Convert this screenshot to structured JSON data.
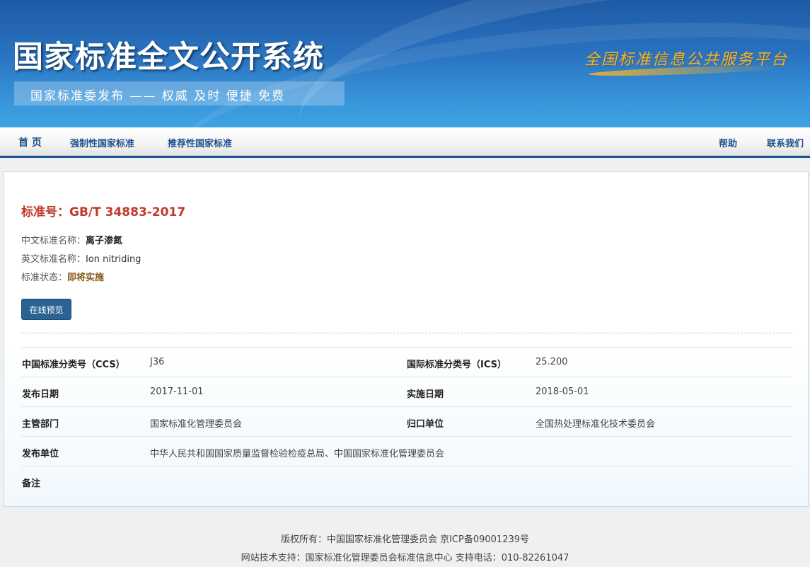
{
  "banner": {
    "title": "国家标准全文公开系统",
    "subtitle": "国家标准委发布 —— 权威 及时 便捷 免费",
    "platform": "全国标准信息公共服务平台"
  },
  "nav": {
    "home": "首 页",
    "mandatory": "强制性国家标准",
    "recommended": "推荐性国家标准",
    "help": "帮助",
    "contact": "联系我们"
  },
  "standard": {
    "number_label": "标准号：GB/T 34883-2017",
    "cn_name_label": "中文标准名称：",
    "cn_name": "离子渗氮",
    "en_name_label": "英文标准名称：",
    "en_name": "Ion nitriding",
    "status_label": "标准状态：",
    "status": "即将实施",
    "preview_button": "在线预览"
  },
  "details": [
    {
      "label1": "中国标准分类号（CCS）",
      "value1": "J36",
      "label2": "国际标准分类号（ICS）",
      "value2": "25.200"
    },
    {
      "label1": "发布日期",
      "value1": "2017-11-01",
      "label2": "实施日期",
      "value2": "2018-05-01"
    },
    {
      "label1": "主管部门",
      "value1": "国家标准化管理委员会",
      "label2": "归口单位",
      "value2": "全国热处理标准化技术委员会"
    },
    {
      "label1": "发布单位",
      "value1": "中华人民共和国国家质量监督检验检疫总局、中国国家标准化管理委员会",
      "label2": "",
      "value2": ""
    },
    {
      "label1": "备注",
      "value1": "",
      "label2": "",
      "value2": ""
    }
  ],
  "footer": {
    "line1": "版权所有：中国国家标准化管理委员会 京ICP备09001239号",
    "line2": "网站技术支持：国家标准化管理委员会标准信息中心 支持电话：010-82261047"
  }
}
